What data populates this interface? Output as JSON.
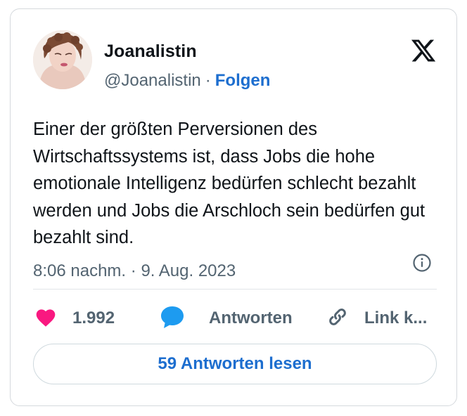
{
  "author": {
    "name": "Joanalistin",
    "handle": "@Joanalistin",
    "separator": "·",
    "follow_label": "Folgen"
  },
  "tweet": {
    "text": "Einer der größten Perversionen des Wirtschaftssystems ist, dass Jobs die hohe emotionale Intelligenz bedürfen schlecht bezahlt werden und Jobs die Arschloch sein bedürfen gut bezahlt sind.",
    "time": "8:06 nachm.",
    "separator": "·",
    "date": "9. Aug. 2023"
  },
  "actions": {
    "like_count": "1.992",
    "reply_label": "Antworten",
    "link_label": "Link k..."
  },
  "read_replies_label": "59 Antworten lesen",
  "icons": {
    "brand": "x-logo-icon",
    "info": "info-icon",
    "like": "heart-icon",
    "reply": "speech-bubble-icon",
    "link": "link-icon"
  },
  "colors": {
    "like": "#f91880",
    "reply": "#1d9bf0",
    "link_accent": "#1d6ecf",
    "muted": "#536471"
  }
}
